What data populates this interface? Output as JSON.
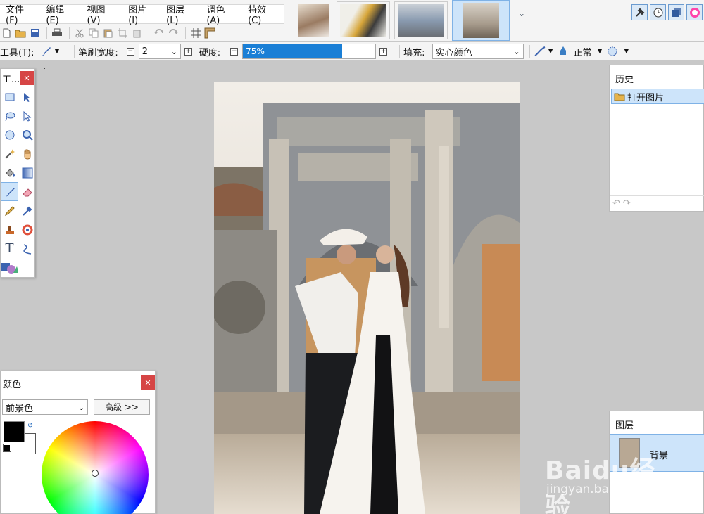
{
  "menu": [
    "文件(F)",
    "编辑(E)",
    "视图(V)",
    "图片(I)",
    "图层(L)",
    "调色(A)",
    "特效(C)"
  ],
  "toolbar2": {
    "tool_label": "工具(T):",
    "brush_width_label": "笔刷宽度:",
    "brush_width_value": "2",
    "hardness_label": "硬度:",
    "hardness_text": "75%",
    "hardness_value": 0.75,
    "fill_label": "填充:",
    "fill_value": "实心颜色",
    "blend_value": "正常"
  },
  "tools_window": {
    "title": "工..."
  },
  "colors_window": {
    "title": "颜色",
    "mode": "前景色",
    "advanced_button": "高级 >>",
    "primary_color": "#000000",
    "secondary_color": "#ffffff"
  },
  "history_window": {
    "title": "历史",
    "items": [
      "打开图片"
    ]
  },
  "layers_window": {
    "title": "图层",
    "layers": [
      "背景"
    ]
  },
  "watermark": {
    "brand": "Baidu经验",
    "url": "jingyan.baidu.com"
  }
}
